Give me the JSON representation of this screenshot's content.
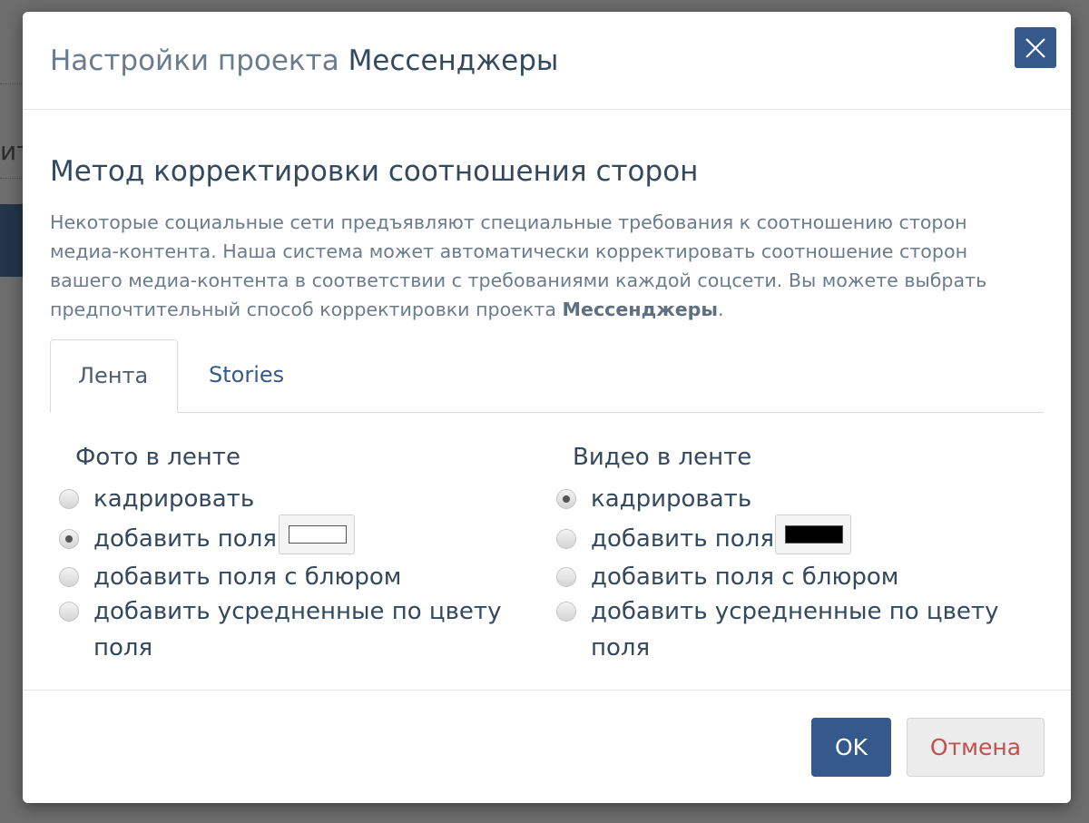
{
  "background": {
    "text_fragment": "ит"
  },
  "modal": {
    "title_prefix": "Настройки проекта",
    "project_name": "Мессенджеры",
    "close_icon": "close-icon"
  },
  "section": {
    "title": "Метод корректировки соотношения сторон",
    "description_main": "Некоторые социальные сети предъявляют специальные требования к соотношению сторон медиа-контента. Наша система может автоматически корректировать соотношение сторон вашего медиа-контента в соответствии с требованиями каждой соцсети. Вы можете выбрать предпочтительный способ корректировки проекта",
    "description_project": "Мессенджеры",
    "description_end": "."
  },
  "tabs": [
    {
      "label": "Лента",
      "active": true
    },
    {
      "label": "Stories",
      "active": false
    }
  ],
  "photo": {
    "title": "Фото в ленте",
    "options": [
      {
        "label": "кадрировать",
        "checked": false
      },
      {
        "label": "добавить поля",
        "checked": true,
        "swatch_color": "#ffffff"
      },
      {
        "label": "добавить поля с блюром",
        "checked": false
      },
      {
        "label_line1": "добавить усредненные по цвету",
        "label_line2": "поля",
        "checked": false
      }
    ]
  },
  "video": {
    "title": "Видео в ленте",
    "options": [
      {
        "label": "кадрировать",
        "checked": true
      },
      {
        "label": "добавить поля",
        "checked": false,
        "swatch_color": "#000000"
      },
      {
        "label": "добавить поля с блюром",
        "checked": false
      },
      {
        "label_line1": "добавить усредненные по цвету",
        "label_line2": "поля",
        "checked": false
      }
    ]
  },
  "footer": {
    "ok_label": "OK",
    "cancel_label": "Отмена"
  },
  "colors": {
    "primary": "#34598a",
    "cancel_text": "#c0504d",
    "title_text": "#34495e",
    "muted_text": "#6b7c8e"
  }
}
